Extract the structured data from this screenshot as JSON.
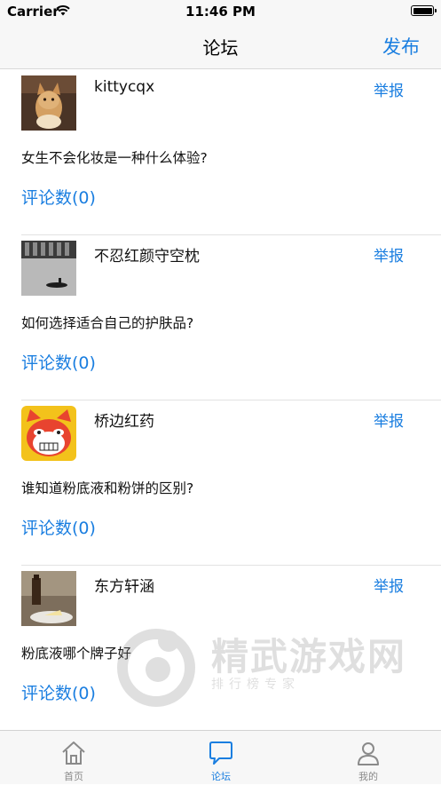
{
  "status_bar": {
    "carrier": "Carrier",
    "time": "11:46 PM"
  },
  "nav": {
    "title": "论坛",
    "publish_label": "发布"
  },
  "posts": [
    {
      "username": "kittycqx",
      "title": "女生不会化妆是一种什么体验?",
      "report_label": "举报",
      "comments_label": "评论数(0)"
    },
    {
      "username": "不忍红颜守空枕",
      "title": "如何选择适合自己的护肤品?",
      "report_label": "举报",
      "comments_label": "评论数(0)"
    },
    {
      "username": "桥边红药",
      "title": "谁知道粉底液和粉饼的区别?",
      "report_label": "举报",
      "comments_label": "评论数(0)"
    },
    {
      "username": "东方轩涵",
      "title": "粉底液哪个牌子好",
      "report_label": "举报",
      "comments_label": "评论数(0)"
    }
  ],
  "watermark": {
    "text": "精武游戏网",
    "subtext": "排行榜专家"
  },
  "tabs": [
    {
      "label": "首页",
      "icon": "home-icon",
      "active": false
    },
    {
      "label": "论坛",
      "icon": "chat-bubble-icon",
      "active": true
    },
    {
      "label": "我的",
      "icon": "person-icon",
      "active": false
    }
  ],
  "colors": {
    "accent": "#1a7ee0",
    "bar_background": "#f7f7f7",
    "inactive_tab": "#8a8a8a"
  }
}
